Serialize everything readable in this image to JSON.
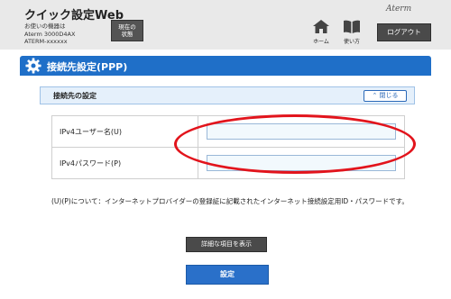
{
  "header": {
    "title": "クイック設定Web",
    "device_lines": [
      "お使いの機器は",
      "Aterm 3000D4AX",
      "ATERM-xxxxxx"
    ],
    "status_button": [
      "現在の",
      "状態"
    ],
    "home_label": "ホーム",
    "help_label": "使い方",
    "brand": "Aterm",
    "logout_label": "ログアウト"
  },
  "section": {
    "title": "接続先設定(PPP)"
  },
  "panel": {
    "title": "接続先の設定",
    "collapse_label": "閉じる"
  },
  "form": {
    "fields": [
      {
        "label": "IPv4ユーザー名(U)",
        "value": ""
      },
      {
        "label": "IPv4パスワード(P)",
        "value": ""
      }
    ]
  },
  "note": "(U)(P)について：インターネットプロバイダーの登録証に記載されたインターネット接続設定用ID・パスワードです。",
  "buttons": {
    "details": "詳細な項目を表示",
    "submit": "設定"
  },
  "colors": {
    "accent": "#1f6fc8",
    "annotation": "#e2141c",
    "header_bg": "#e9e9e9"
  }
}
